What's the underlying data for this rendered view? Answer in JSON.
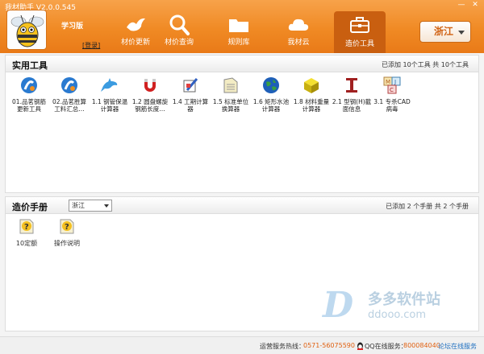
{
  "window": {
    "title": "我材助手 V2.0.0.545",
    "min": "—",
    "close": "✕"
  },
  "brand": {
    "edition": "学习版",
    "login": "[登录]"
  },
  "nav": [
    {
      "label": "材价更新",
      "icon": "bird-icon"
    },
    {
      "label": "材价查询",
      "icon": "magnifier-icon"
    },
    {
      "label": "规则库",
      "icon": "folder-icon"
    },
    {
      "label": "我材云",
      "icon": "cloud-icon"
    },
    {
      "label": "造价工具",
      "icon": "toolbox-icon"
    }
  ],
  "province": "浙江",
  "tools_panel": {
    "title": "实用工具",
    "info": "已添加 10个工具    共 10个工具",
    "items": [
      {
        "label": "01.品茗钢筋 更新工具",
        "icon": "pinming-icon"
      },
      {
        "label": "02.品茗胜算 工料汇总…",
        "icon": "pinming-icon"
      },
      {
        "label": "1.1 钢管保温 计算器",
        "icon": "dolphin-icon"
      },
      {
        "label": "1.2 圆盘螺旋 钢筋长度…",
        "icon": "magnet-icon"
      },
      {
        "label": "1.4 工期计算 器",
        "icon": "pen-icon"
      },
      {
        "label": "1.5 标准单位 换算器",
        "icon": "paper-icon"
      },
      {
        "label": "1.6 矩形水池 计算器",
        "icon": "globe-icon"
      },
      {
        "label": "1.8 材料重量 计算器",
        "icon": "cube-icon"
      },
      {
        "label": "2.1 型钢(H)截 面信息",
        "icon": "ibeam-icon"
      },
      {
        "label": "3.1 专杀CAD 病毒",
        "icon": "mjc-blocks-icon"
      }
    ]
  },
  "manual_panel": {
    "title": "造价手册",
    "select": "浙江",
    "info": "已添加  2 个手册    共  2 个手册",
    "items": [
      {
        "label": "10定额",
        "icon": "help-doc-icon"
      },
      {
        "label": "操作说明",
        "icon": "help-doc-icon"
      }
    ]
  },
  "watermark": {
    "cn": "多多软件站",
    "url": "ddooo.com"
  },
  "status": {
    "hotline_label": "运营服务热线：",
    "hotline": "0571-56075590",
    "qq_label": "QQ在线服务：",
    "qq": "800084040",
    "forum": "论坛在线服务"
  },
  "colors": {
    "header": "#f08a24",
    "accent": "#e06010",
    "link": "#1e6fc0"
  }
}
